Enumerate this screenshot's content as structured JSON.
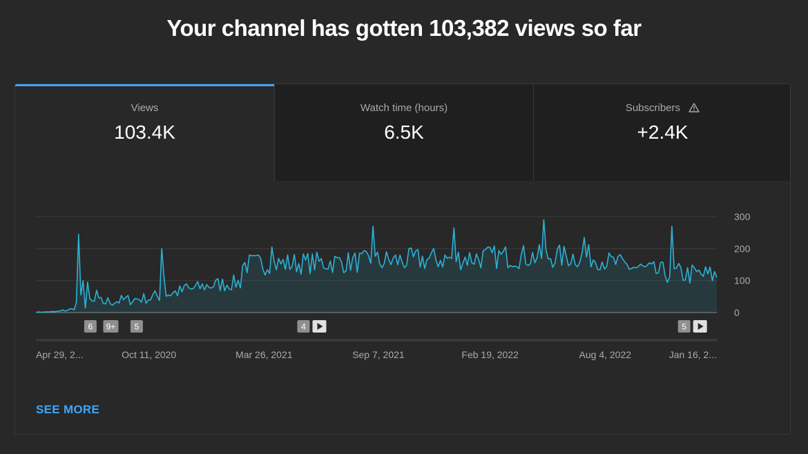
{
  "headline": "Your channel has gotten 103,382 views so far",
  "tabs": [
    {
      "label": "Views",
      "value": "103.4K",
      "active": true
    },
    {
      "label": "Watch time (hours)",
      "value": "6.5K",
      "active": false
    },
    {
      "label": "Subscribers",
      "value": "+2.4K",
      "active": false,
      "icon": "warning-icon"
    }
  ],
  "see_more": "SEE MORE",
  "colors": {
    "accent": "#3ea6ff",
    "line": "#2bb2d6",
    "background": "#282828"
  },
  "chart_data": {
    "type": "area",
    "ylim": [
      0,
      300
    ],
    "yticks": [
      0,
      100,
      200,
      300
    ],
    "x_tick_labels": [
      "Apr 29, 2...",
      "Oct 11, 2020",
      "Mar 26, 2021",
      "Sep 7, 2021",
      "Feb 19, 2022",
      "Aug 4, 2022",
      "Jan 16, 2..."
    ],
    "grid": true,
    "series": [
      {
        "segments": [
          {
            "start": 0,
            "end": 10,
            "from": 1,
            "to": 3,
            "noise": 1
          },
          {
            "start": 10,
            "end": 8,
            "from": 3,
            "to": 12,
            "noise": 4
          },
          {
            "start": 18,
            "end": 32,
            "from": 25,
            "to": 45,
            "noise": 18
          },
          {
            "start": 50,
            "end": 28,
            "from": 45,
            "to": 85,
            "noise": 22
          },
          {
            "start": 78,
            "end": 14,
            "from": 85,
            "to": 95,
            "noise": 25
          },
          {
            "start": 92,
            "end": 60,
            "from": 150,
            "to": 160,
            "noise": 35
          },
          {
            "start": 152,
            "end": 58,
            "from": 160,
            "to": 175,
            "noise": 38
          },
          {
            "start": 210,
            "end": 38,
            "from": 175,
            "to": 175,
            "noise": 38
          },
          {
            "start": 248,
            "end": 30,
            "from": 170,
            "to": 125,
            "noise": 32
          },
          {
            "start": 278,
            "end": 26,
            "from": 125,
            "to": 115,
            "noise": 35
          }
        ],
        "spikes": [
          {
            "index": 19,
            "value": 245
          },
          {
            "index": 20,
            "value": 55
          },
          {
            "index": 21,
            "value": 100
          },
          {
            "index": 23,
            "value": 95
          },
          {
            "index": 27,
            "value": 70
          },
          {
            "index": 56,
            "value": 200
          },
          {
            "index": 57,
            "value": 110
          },
          {
            "index": 67,
            "value": 90
          },
          {
            "index": 105,
            "value": 205
          },
          {
            "index": 150,
            "value": 270
          },
          {
            "index": 186,
            "value": 265
          },
          {
            "index": 226,
            "value": 290
          },
          {
            "index": 244,
            "value": 235
          },
          {
            "index": 283,
            "value": 270
          }
        ],
        "points": 304,
        "seed": 7
      }
    ],
    "markers": [
      {
        "label": "6",
        "pos": 0.08,
        "play": false
      },
      {
        "label": "9+",
        "pos": 0.11,
        "play": false
      },
      {
        "label": "5",
        "pos": 0.148,
        "play": false
      },
      {
        "label": "4",
        "pos": 0.393,
        "play": true
      },
      {
        "label": "5",
        "pos": 0.952,
        "play": true
      }
    ]
  }
}
